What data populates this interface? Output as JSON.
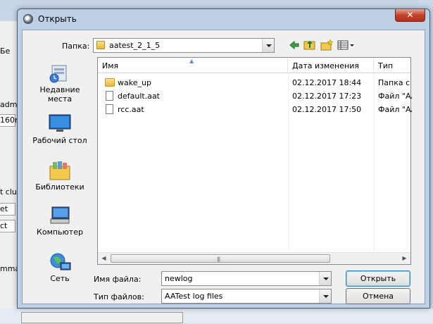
{
  "background": {
    "fragments": [
      "Бе",
      "adma",
      "160r",
      "t clu",
      "et",
      "ct",
      "mman"
    ]
  },
  "dialog": {
    "title": "Открыть",
    "close_glyph": "✕",
    "lookin_label": "Папка:",
    "lookin_value": "aatest_2_1_5",
    "toolbar_icons": [
      "back-arrow-icon",
      "up-folder-icon",
      "new-folder-icon",
      "view-menu-icon"
    ],
    "places": [
      {
        "label": "Недавние места",
        "icon": "recent-places-icon"
      },
      {
        "label": "Рабочий стол",
        "icon": "desktop-icon"
      },
      {
        "label": "Библиотеки",
        "icon": "libraries-icon"
      },
      {
        "label": "Компьютер",
        "icon": "computer-icon"
      },
      {
        "label": "Сеть",
        "icon": "network-icon"
      }
    ],
    "columns": [
      "Имя",
      "Дата изменения",
      "Тип"
    ],
    "files": [
      {
        "name": "wake_up",
        "date": "02.12.2017 18:44",
        "type": "Папка с ф",
        "kind": "folder"
      },
      {
        "name": "default.aat",
        "date": "02.12.2017 17:23",
        "type": "Файл \"AA",
        "kind": "file"
      },
      {
        "name": "rcc.aat",
        "date": "02.12.2017 17:50",
        "type": "Файл \"AA",
        "kind": "file"
      }
    ],
    "filename_label": "Имя файла:",
    "filename_value": "newlog",
    "filetype_label": "Тип файлов:",
    "filetype_value": "AATest log files",
    "open_button": "Открыть",
    "cancel_button": "Отмена"
  }
}
